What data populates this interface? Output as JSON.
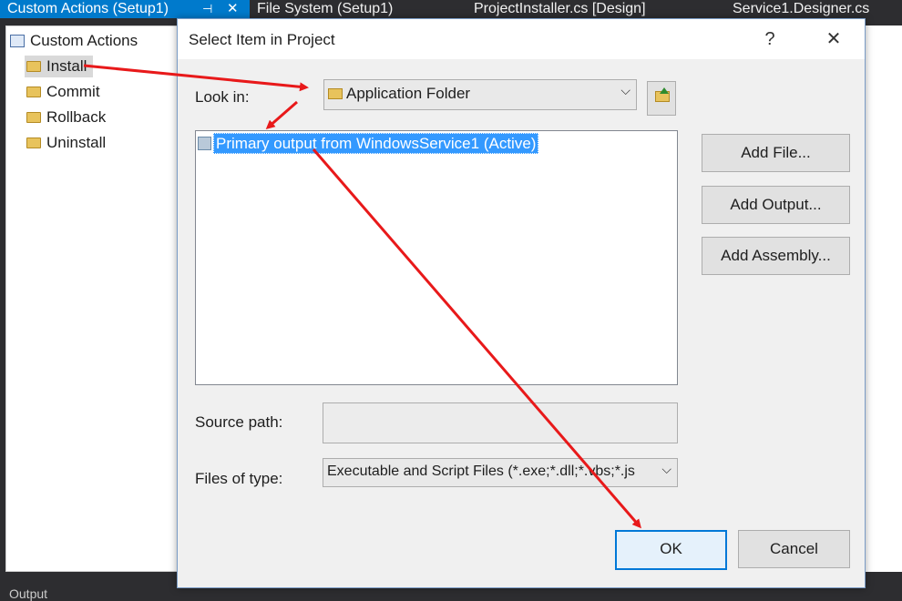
{
  "vs_tabs": {
    "active_tab": "Custom Actions (Setup1)",
    "pin_icon": "⊣",
    "close_icon": "✕",
    "tab2": "File System (Setup1)",
    "tab3": "ProjectInstaller.cs [Design]",
    "tab4": "Service1.Designer.cs"
  },
  "tree": {
    "root": "Custom Actions",
    "items": [
      {
        "label": "Install"
      },
      {
        "label": "Commit"
      },
      {
        "label": "Rollback"
      },
      {
        "label": "Uninstall"
      }
    ]
  },
  "bottom_bar": {
    "text": "Output"
  },
  "dialog": {
    "title": "Select Item in Project",
    "help_label": "?",
    "close_label": "✕",
    "look_in_label": "Look in:",
    "look_in_value": "Application Folder",
    "list_items": [
      "Primary output from WindowsService1 (Active)"
    ],
    "add_file": "Add File...",
    "add_output": "Add Output...",
    "add_assembly": "Add Assembly...",
    "source_path_label": "Source path:",
    "source_path_value": "",
    "files_of_type_label": "Files of type:",
    "files_of_type_value": "Executable and Script Files (*.exe;*.dll;*.vbs;*.js",
    "ok": "OK",
    "cancel": "Cancel",
    "chevron": "⌵"
  },
  "colors": {
    "accent": "#007acc",
    "selection": "#3399ff",
    "annotation_arrow": "#e8191a"
  }
}
